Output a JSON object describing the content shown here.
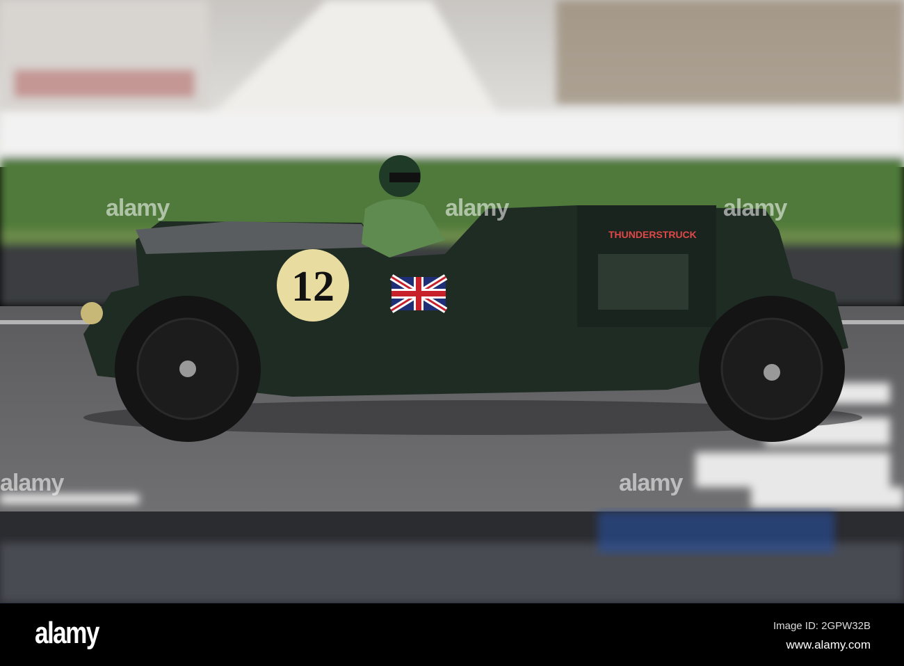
{
  "photo": {
    "subject": "vintage green racing car",
    "car_number": "12",
    "car_name": "THUNDERSTRUCK",
    "watermark": "alamy",
    "colors": {
      "body": "#1f2c24",
      "track": "#6e6e70",
      "hedge": "#4f7a3a",
      "plate": "#e8dca0"
    }
  },
  "footer": {
    "logo": "alamy",
    "image_id": "Image ID: 2GPW32B",
    "site": "www.alamy.com"
  }
}
